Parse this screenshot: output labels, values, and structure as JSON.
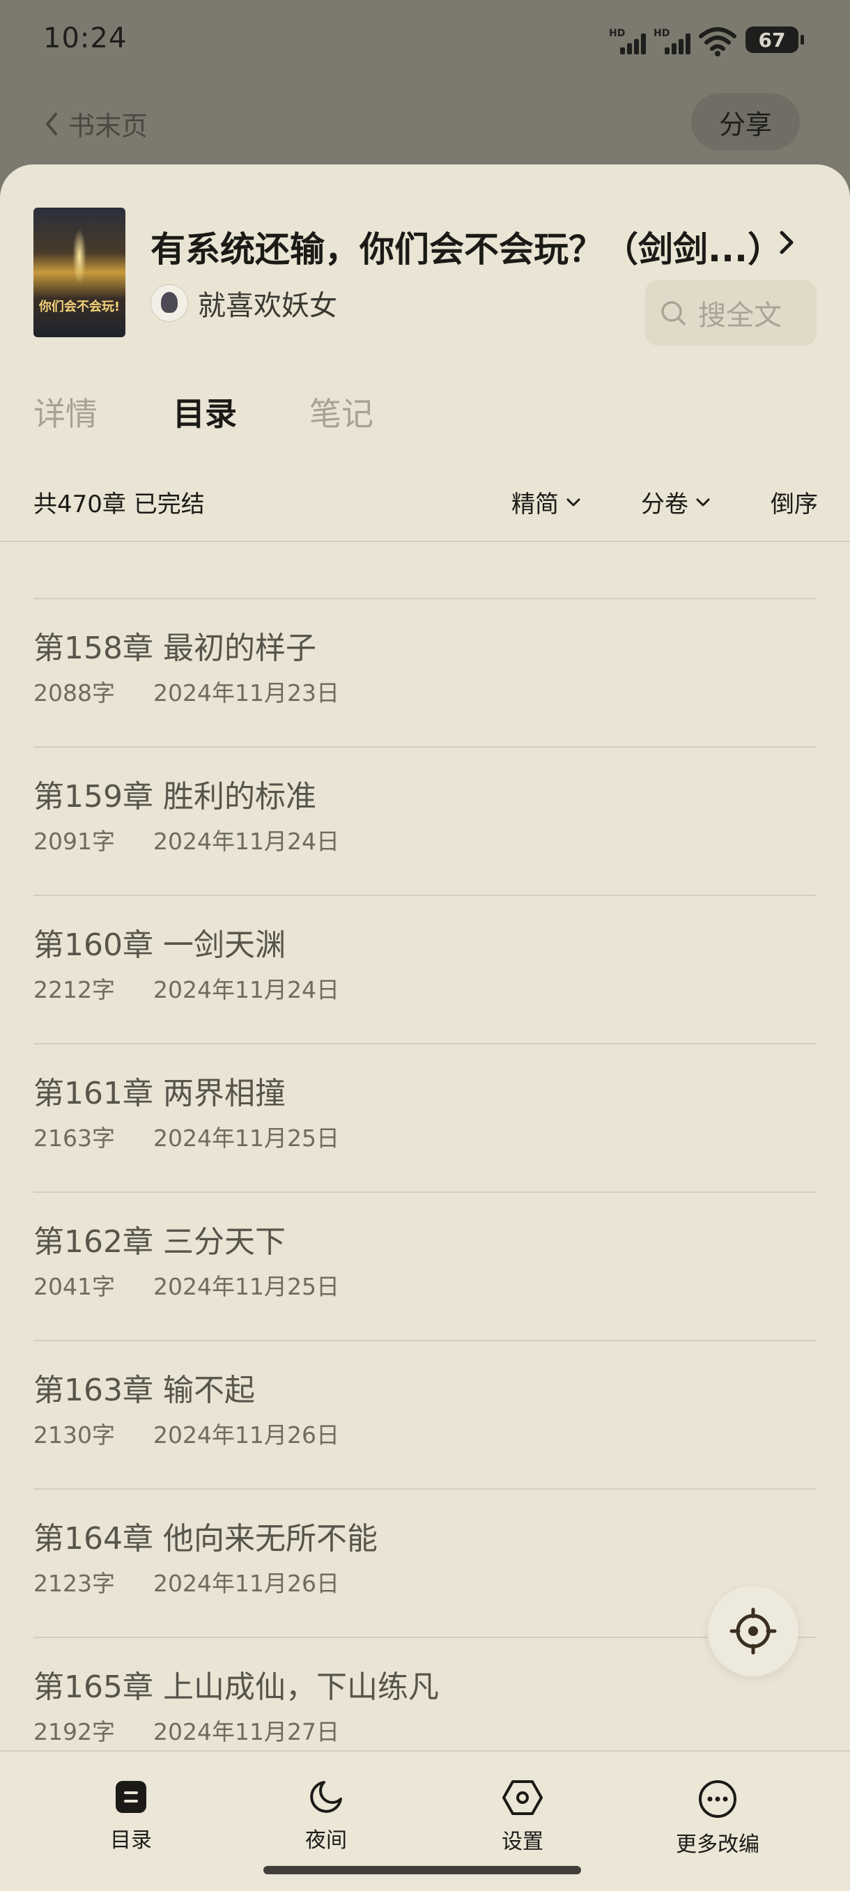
{
  "status_bar": {
    "time": "10:24",
    "signal_label": "HD",
    "battery": "67"
  },
  "header": {
    "back_label": "书末页",
    "share_label": "分享"
  },
  "book": {
    "title": "有系统还输，你们会不会玩？（剑剑...）",
    "author": "就喜欢妖女",
    "cover_text": "你们会不会玩!",
    "search_placeholder": "搜全文"
  },
  "tabs": [
    {
      "label": "详情",
      "active": false
    },
    {
      "label": "目录",
      "active": true
    },
    {
      "label": "笔记",
      "active": false
    }
  ],
  "toc": {
    "summary": "共470章 已完结",
    "filter_simplified": "精简",
    "filter_volume": "分卷",
    "sort_label": "倒序"
  },
  "chapters": [
    {
      "title": "第158章 最初的样子",
      "words": "2088字",
      "date": "2024年11月23日"
    },
    {
      "title": "第159章 胜利的标准",
      "words": "2091字",
      "date": "2024年11月24日"
    },
    {
      "title": "第160章 一剑天渊",
      "words": "2212字",
      "date": "2024年11月24日"
    },
    {
      "title": "第161章 两界相撞",
      "words": "2163字",
      "date": "2024年11月25日"
    },
    {
      "title": "第162章 三分天下",
      "words": "2041字",
      "date": "2024年11月25日"
    },
    {
      "title": "第163章 输不起",
      "words": "2130字",
      "date": "2024年11月26日"
    },
    {
      "title": "第164章 他向来无所不能",
      "words": "2123字",
      "date": "2024年11月26日"
    },
    {
      "title": "第165章 上山成仙，下山练凡",
      "words": "2192字",
      "date": "2024年11月27日"
    }
  ],
  "bottom_nav": [
    {
      "label": "目录",
      "icon": "toc-icon"
    },
    {
      "label": "夜间",
      "icon": "moon-icon"
    },
    {
      "label": "设置",
      "icon": "settings-icon"
    },
    {
      "label": "更多改编",
      "icon": "more-icon"
    }
  ]
}
